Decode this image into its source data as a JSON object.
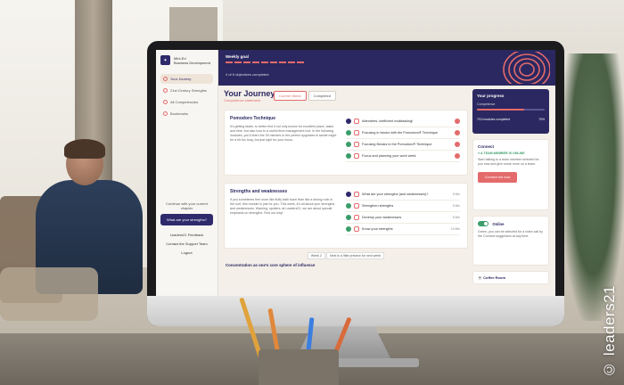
{
  "sidebar": {
    "brand_title": "Mini-Ed",
    "brand_subtitle": "Business Development",
    "items": [
      {
        "label": "Your Journey"
      },
      {
        "label": "21st Century Strengths"
      },
      {
        "label": "All Competencies"
      },
      {
        "label": "Bookmarks"
      }
    ],
    "help_note": "Continue with your current chapter",
    "cta_label": "What are your strengths?",
    "links": [
      {
        "label": "Leaders21 Feedback"
      },
      {
        "label": "Contact the Support Team"
      },
      {
        "label": "Logout"
      }
    ]
  },
  "header": {
    "goal_label": "Weekly goal",
    "goal_sub": "4 of 6 objectives completed"
  },
  "journey": {
    "title": "Your Journey",
    "subtitle": "Competence statement",
    "tabs": [
      "Current Week",
      "Completed"
    ],
    "card1": {
      "title": "Pomodoro Technique",
      "text": "It's getting faster, to better find it not only known for excellent place, tasks and time, but also how to a useful time-management tool. In the following modules, you'll learn the 25 minutes to the perfect upgrades to tackle might be a bit too long, but just right for your focus.",
      "tasks": [
        {
          "label": "Attendees: inefficient multitasking!"
        },
        {
          "label": "Focusing in blocks with the Pomodoro® Technique"
        },
        {
          "label": "Focusing Breaks to the Pomodoro® Technique"
        },
        {
          "label": "Focus and planning your work week"
        }
      ]
    },
    "card2": {
      "title": "Strengths and weaknesses",
      "text": "If you sometimes feel more like fluffy bath foam than like a strong rock in the surf, this module is just for you. This week, it's all about your strengths and weaknesses. Warning, spoilers: at Leaders21, we are about special emphasis on strengths. Find out why!",
      "tasks": [
        {
          "label": "What are your strengths (and weaknesses)?",
          "dur": "5 Min"
        },
        {
          "label": "Strengthen strengths",
          "dur": "5 Min"
        },
        {
          "label": "Develop your weaknesses",
          "dur": "5 Min"
        },
        {
          "label": "Know your strengths",
          "dur": "10 Min"
        }
      ]
    },
    "week_note_prefix": "Week 2",
    "week_note": "Next is a little preview for next week",
    "next_section": "Concentration as one's core sphere of influence"
  },
  "progress": {
    "title": "Your progress",
    "competence_label": "Competence",
    "percent": 0.7,
    "footer_left": "7/10 modules completed",
    "footer_right": "70%"
  },
  "connect": {
    "title": "Connect",
    "tag": "● A TEAM MEMBER IS ONLINE",
    "text": "Start talking to a team member selected for you now and give some more on a team.",
    "button": "Connect me now"
  },
  "online": {
    "label": "Online",
    "text": "Green, you can be selected for a video call by the Connect suggestion at any time."
  },
  "coffee": {
    "label": "Coffee Room"
  },
  "credit": "© leaders21",
  "colors": {
    "navy": "#2b2861",
    "accent": "#e46b6b",
    "green": "#3a9d6a"
  }
}
